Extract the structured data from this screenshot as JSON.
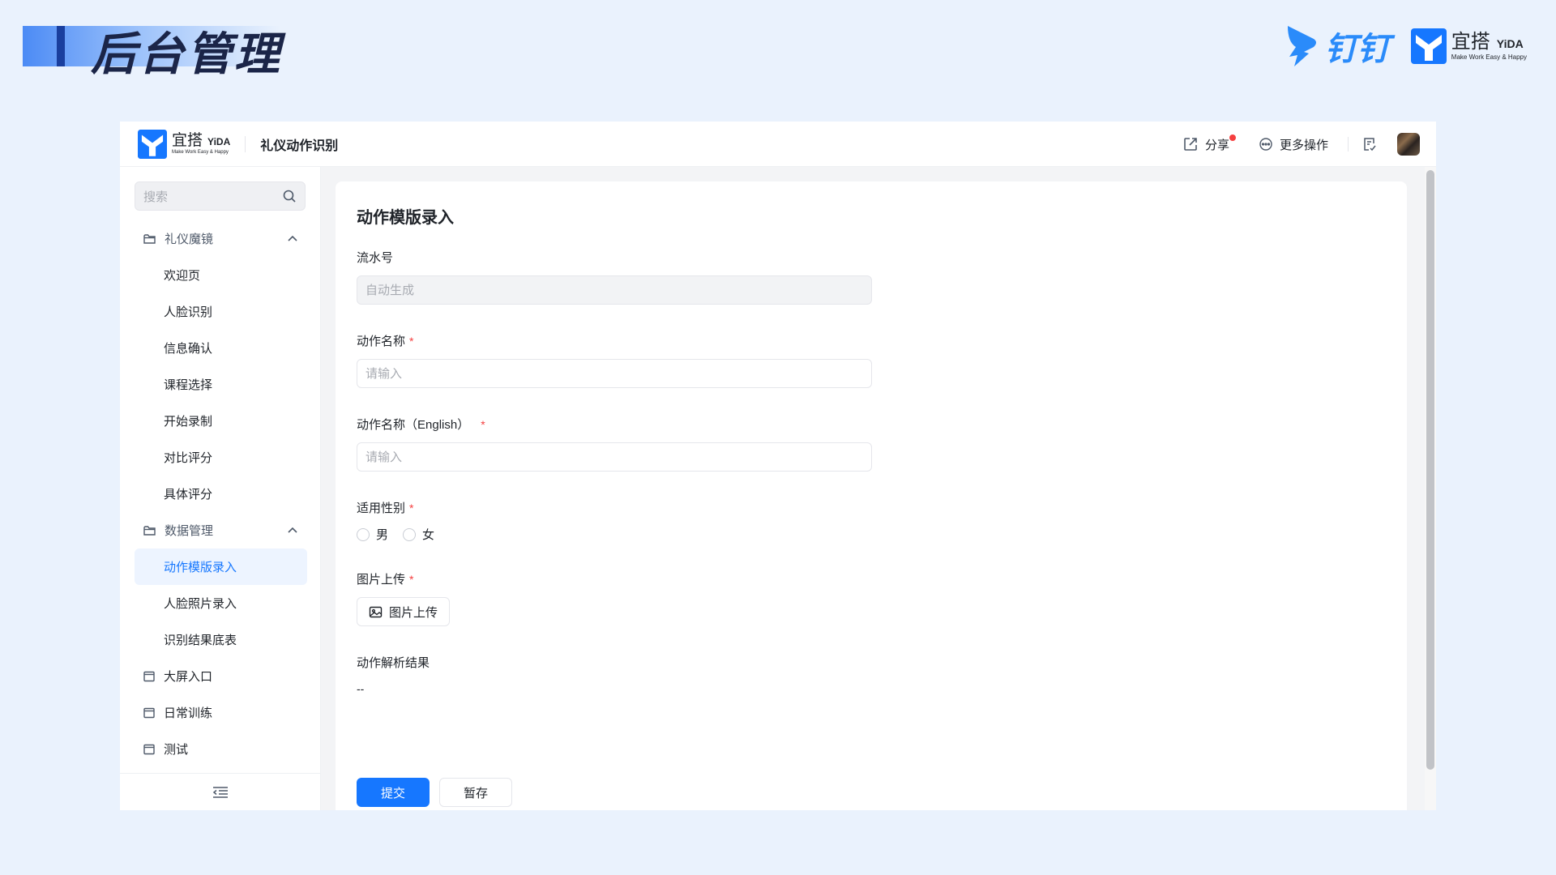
{
  "slide": {
    "title": "后台管理",
    "logo_dingtalk": "钉钉",
    "logo_yida_cn": "宜搭",
    "logo_yida_en": "YiDA",
    "logo_yida_tagline": "Make Work Easy & Happy"
  },
  "topbar": {
    "logo_cn": "宜搭",
    "logo_en": "YiDA",
    "logo_tagline": "Make Work Easy & Happy",
    "app_name": "礼仪动作识别",
    "share_label": "分享",
    "more_label": "更多操作"
  },
  "sidebar": {
    "search_placeholder": "搜索",
    "groups": [
      {
        "label": "礼仪魔镜",
        "items": [
          "欢迎页",
          "人脸识别",
          "信息确认",
          "课程选择",
          "开始录制",
          "对比评分",
          "具体评分"
        ]
      },
      {
        "label": "数据管理",
        "items": [
          "动作模版录入",
          "人脸照片录入",
          "识别结果底表"
        ],
        "active": "动作模版录入"
      }
    ],
    "pages": [
      "大屏入口",
      "日常训练",
      "测试"
    ]
  },
  "form": {
    "title": "动作模版录入",
    "serial": {
      "label": "流水号",
      "placeholder": "自动生成"
    },
    "name": {
      "label": "动作名称",
      "placeholder": "请输入",
      "required_mark": "*"
    },
    "name_en": {
      "label": "动作名称（English）",
      "placeholder": "请输入",
      "required_mark": "*"
    },
    "gender": {
      "label": "适用性别",
      "required_mark": "*",
      "options": [
        "男",
        "女"
      ]
    },
    "image": {
      "label": "图片上传",
      "required_mark": "*",
      "button": "图片上传"
    },
    "result": {
      "label": "动作解析结果",
      "value": "--"
    },
    "submit_label": "提交",
    "draft_label": "暂存"
  },
  "colors": {
    "primary": "#1677ff",
    "required": "#f53f3f",
    "page_bg": "#eaf2fd",
    "dingtalk_blue": "#2a8bfa"
  }
}
